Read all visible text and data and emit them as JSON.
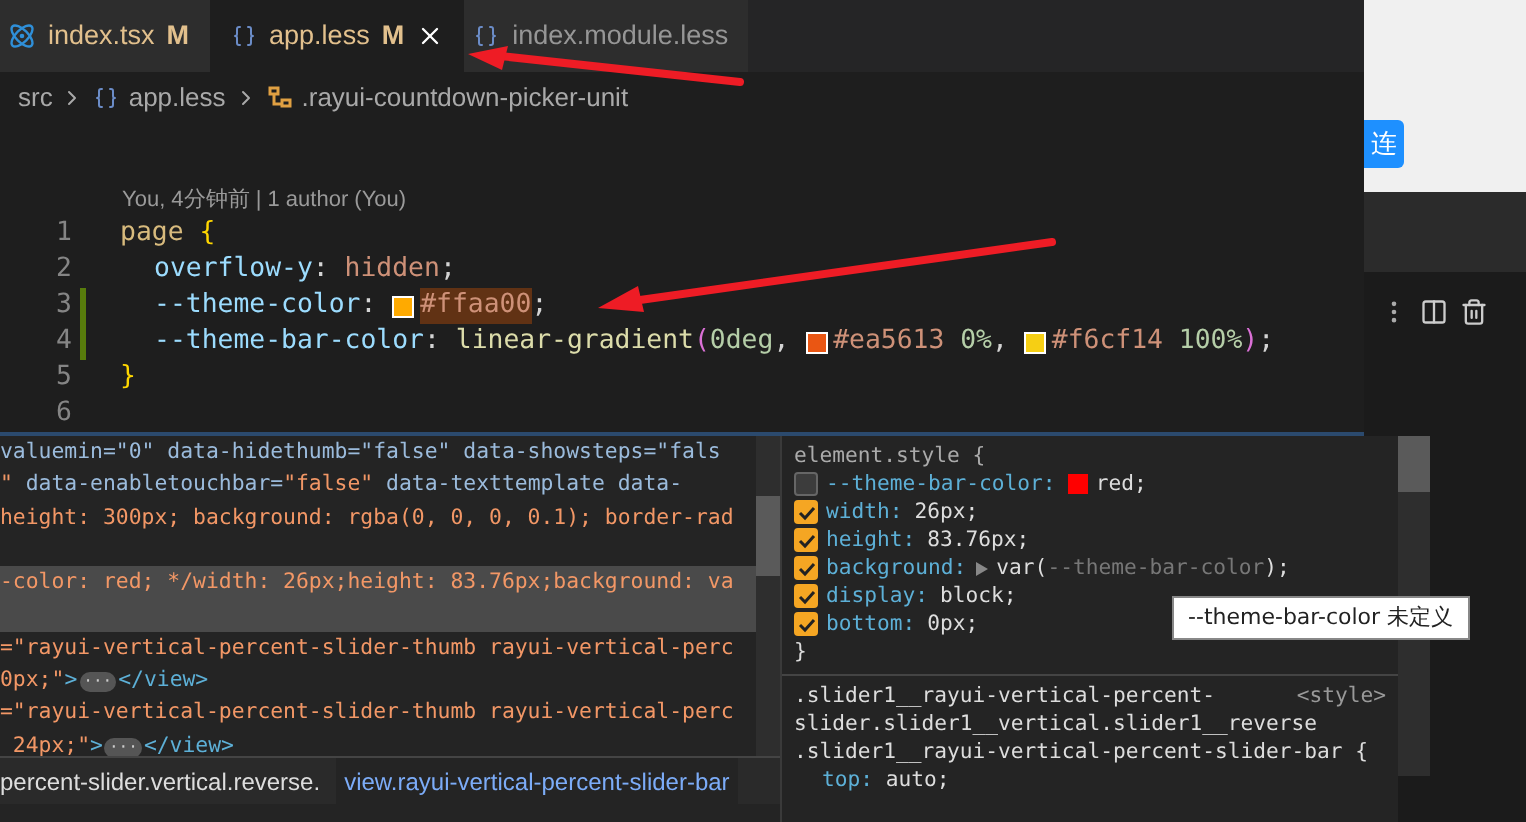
{
  "editor": {
    "tabs": [
      {
        "label": "index.tsx",
        "badge": "M",
        "kind": "tsx",
        "selected": false
      },
      {
        "label": "app.less",
        "badge": "M",
        "kind": "less",
        "selected": true
      },
      {
        "label": "index.module.less",
        "kind": "less",
        "selected": false
      }
    ],
    "breadcrumbs": [
      {
        "label": "src",
        "kind": "folder"
      },
      {
        "label": "app.less",
        "kind": "less"
      },
      {
        "label": ".rayui-countdown-picker-unit",
        "kind": "selector"
      }
    ],
    "blame": "You, 4分钟前 | 1 author (You)",
    "lines": [
      {
        "number": "1",
        "kind": "open",
        "modified": false,
        "tokens": [
          {
            "kind": "sel",
            "text": "page"
          },
          {
            "kind": "brace",
            "text": " {"
          }
        ]
      },
      {
        "number": "2",
        "kind": "decl",
        "modified": false,
        "tokens": [
          {
            "kind": "prop",
            "text": "overflow-y"
          },
          {
            "kind": "p",
            "text": ": "
          },
          {
            "kind": "val",
            "text": "hidden"
          },
          {
            "kind": "p",
            "text": ";"
          }
        ]
      },
      {
        "number": "3",
        "kind": "decl",
        "modified": true,
        "tokens": [
          {
            "kind": "prop",
            "text": "--theme-color"
          },
          {
            "kind": "p",
            "text": ": "
          },
          {
            "kind": "swatch",
            "color": "#ffaa00"
          },
          {
            "kind": "hl",
            "text": "#ffaa00"
          },
          {
            "kind": "p",
            "text": ";"
          }
        ]
      },
      {
        "number": "4",
        "kind": "decl",
        "modified": true,
        "tokens": [
          {
            "kind": "prop",
            "text": "--theme-bar-color"
          },
          {
            "kind": "p",
            "text": ": "
          },
          {
            "kind": "fn",
            "text": "linear-gradient"
          },
          {
            "kind": "paren",
            "text": "("
          },
          {
            "kind": "num",
            "text": "0deg"
          },
          {
            "kind": "p",
            "text": ", "
          },
          {
            "kind": "swatch",
            "color": "#ea5613"
          },
          {
            "kind": "val",
            "text": "#ea5613"
          },
          {
            "kind": "num",
            "text": " 0%"
          },
          {
            "kind": "p",
            "text": ", "
          },
          {
            "kind": "swatch",
            "color": "#f6cf14"
          },
          {
            "kind": "val",
            "text": "#f6cf14"
          },
          {
            "kind": "num",
            "text": " 100%"
          },
          {
            "kind": "paren",
            "text": ")"
          },
          {
            "kind": "p",
            "text": ";"
          }
        ]
      },
      {
        "number": "5",
        "kind": "close",
        "modified": false,
        "tokens": [
          {
            "kind": "brace",
            "text": "}"
          }
        ]
      },
      {
        "number": "6",
        "modified": false
      }
    ]
  },
  "browser": {
    "button": "连"
  },
  "elements": {
    "lines": [
      {
        "selected": false,
        "tokens": [
          {
            "kind": "attr",
            "text": "valuemin=\"0\" data-hidethumb=\"false\" data-showsteps=\"fals"
          }
        ]
      },
      {
        "selected": false,
        "tokens": [
          {
            "kind": "val",
            "text": "\""
          },
          {
            "kind": "attr",
            "text": " data-enabletouchbar="
          },
          {
            "kind": "val",
            "text": "\"false\""
          },
          {
            "kind": "attr",
            "text": " data-texttemplate data-"
          }
        ]
      },
      {
        "selected": false,
        "tokens": [
          {
            "kind": "val",
            "text": "height: 300px; background: rgba(0, 0, 0, 0.1); border-rad"
          }
        ]
      },
      {
        "selected": false
      },
      {
        "selected": true,
        "tokens": [
          {
            "kind": "val",
            "text": "-color: red; */width: 26px;height: 83.76px;background: va"
          }
        ]
      },
      {
        "selected": true
      },
      {
        "selected": false,
        "tokens": [
          {
            "kind": "val",
            "text": "=\"rayui-vertical-percent-slider-thumb rayui-vertical-perc"
          }
        ]
      },
      {
        "selected": false,
        "tokens": [
          {
            "kind": "val",
            "text": "0px;\""
          },
          {
            "kind": "tag",
            "text": ">"
          },
          {
            "kind": "ellipsis",
            "text": "···"
          },
          {
            "kind": "tag",
            "text": "</view>"
          }
        ]
      },
      {
        "selected": false,
        "tokens": [
          {
            "kind": "val",
            "text": "=\"rayui-vertical-percent-slider-thumb rayui-vertical-perc"
          }
        ]
      },
      {
        "selected": false,
        "tokens": [
          {
            "kind": "val",
            "text": " 24px;\""
          },
          {
            "kind": "tag",
            "text": ">"
          },
          {
            "kind": "ellipsis",
            "text": "···"
          },
          {
            "kind": "tag",
            "text": "</view>"
          }
        ]
      }
    ],
    "crumbs": [
      "percent-slider.vertical.reverse.",
      "view.rayui-vertical-percent-slider-bar"
    ]
  },
  "styles": {
    "element_selector": "element.style {",
    "declarations": [
      {
        "prop": "--theme-bar-color:",
        "value": "red;",
        "color": "#ff0000",
        "checked": false,
        "expandable": false
      },
      {
        "prop": "width:",
        "value": "26px;",
        "checked": true,
        "expandable": false
      },
      {
        "prop": "height:",
        "value": "83.76px;",
        "checked": true,
        "expandable": false
      },
      {
        "prop": "background:",
        "value": "var(",
        "var": "--theme-bar-color",
        "value_end": ");",
        "expandable": true,
        "checked": true
      },
      {
        "prop": "display:",
        "value": "block;",
        "checked": true,
        "expandable": false
      },
      {
        "prop": "bottom:",
        "value": "0px;",
        "checked": true,
        "expandable": false
      }
    ],
    "close": "}",
    "tooltip": "--theme-bar-color 未定义",
    "rule": {
      "selector_lines": [
        ".slider1__rayui-vertical-percent-",
        "slider.slider1__vertical.slider1__reverse",
        ".slider1__rayui-vertical-percent-slider-bar {"
      ],
      "source": "<style>",
      "prop": "top:",
      "value": "auto;"
    }
  }
}
